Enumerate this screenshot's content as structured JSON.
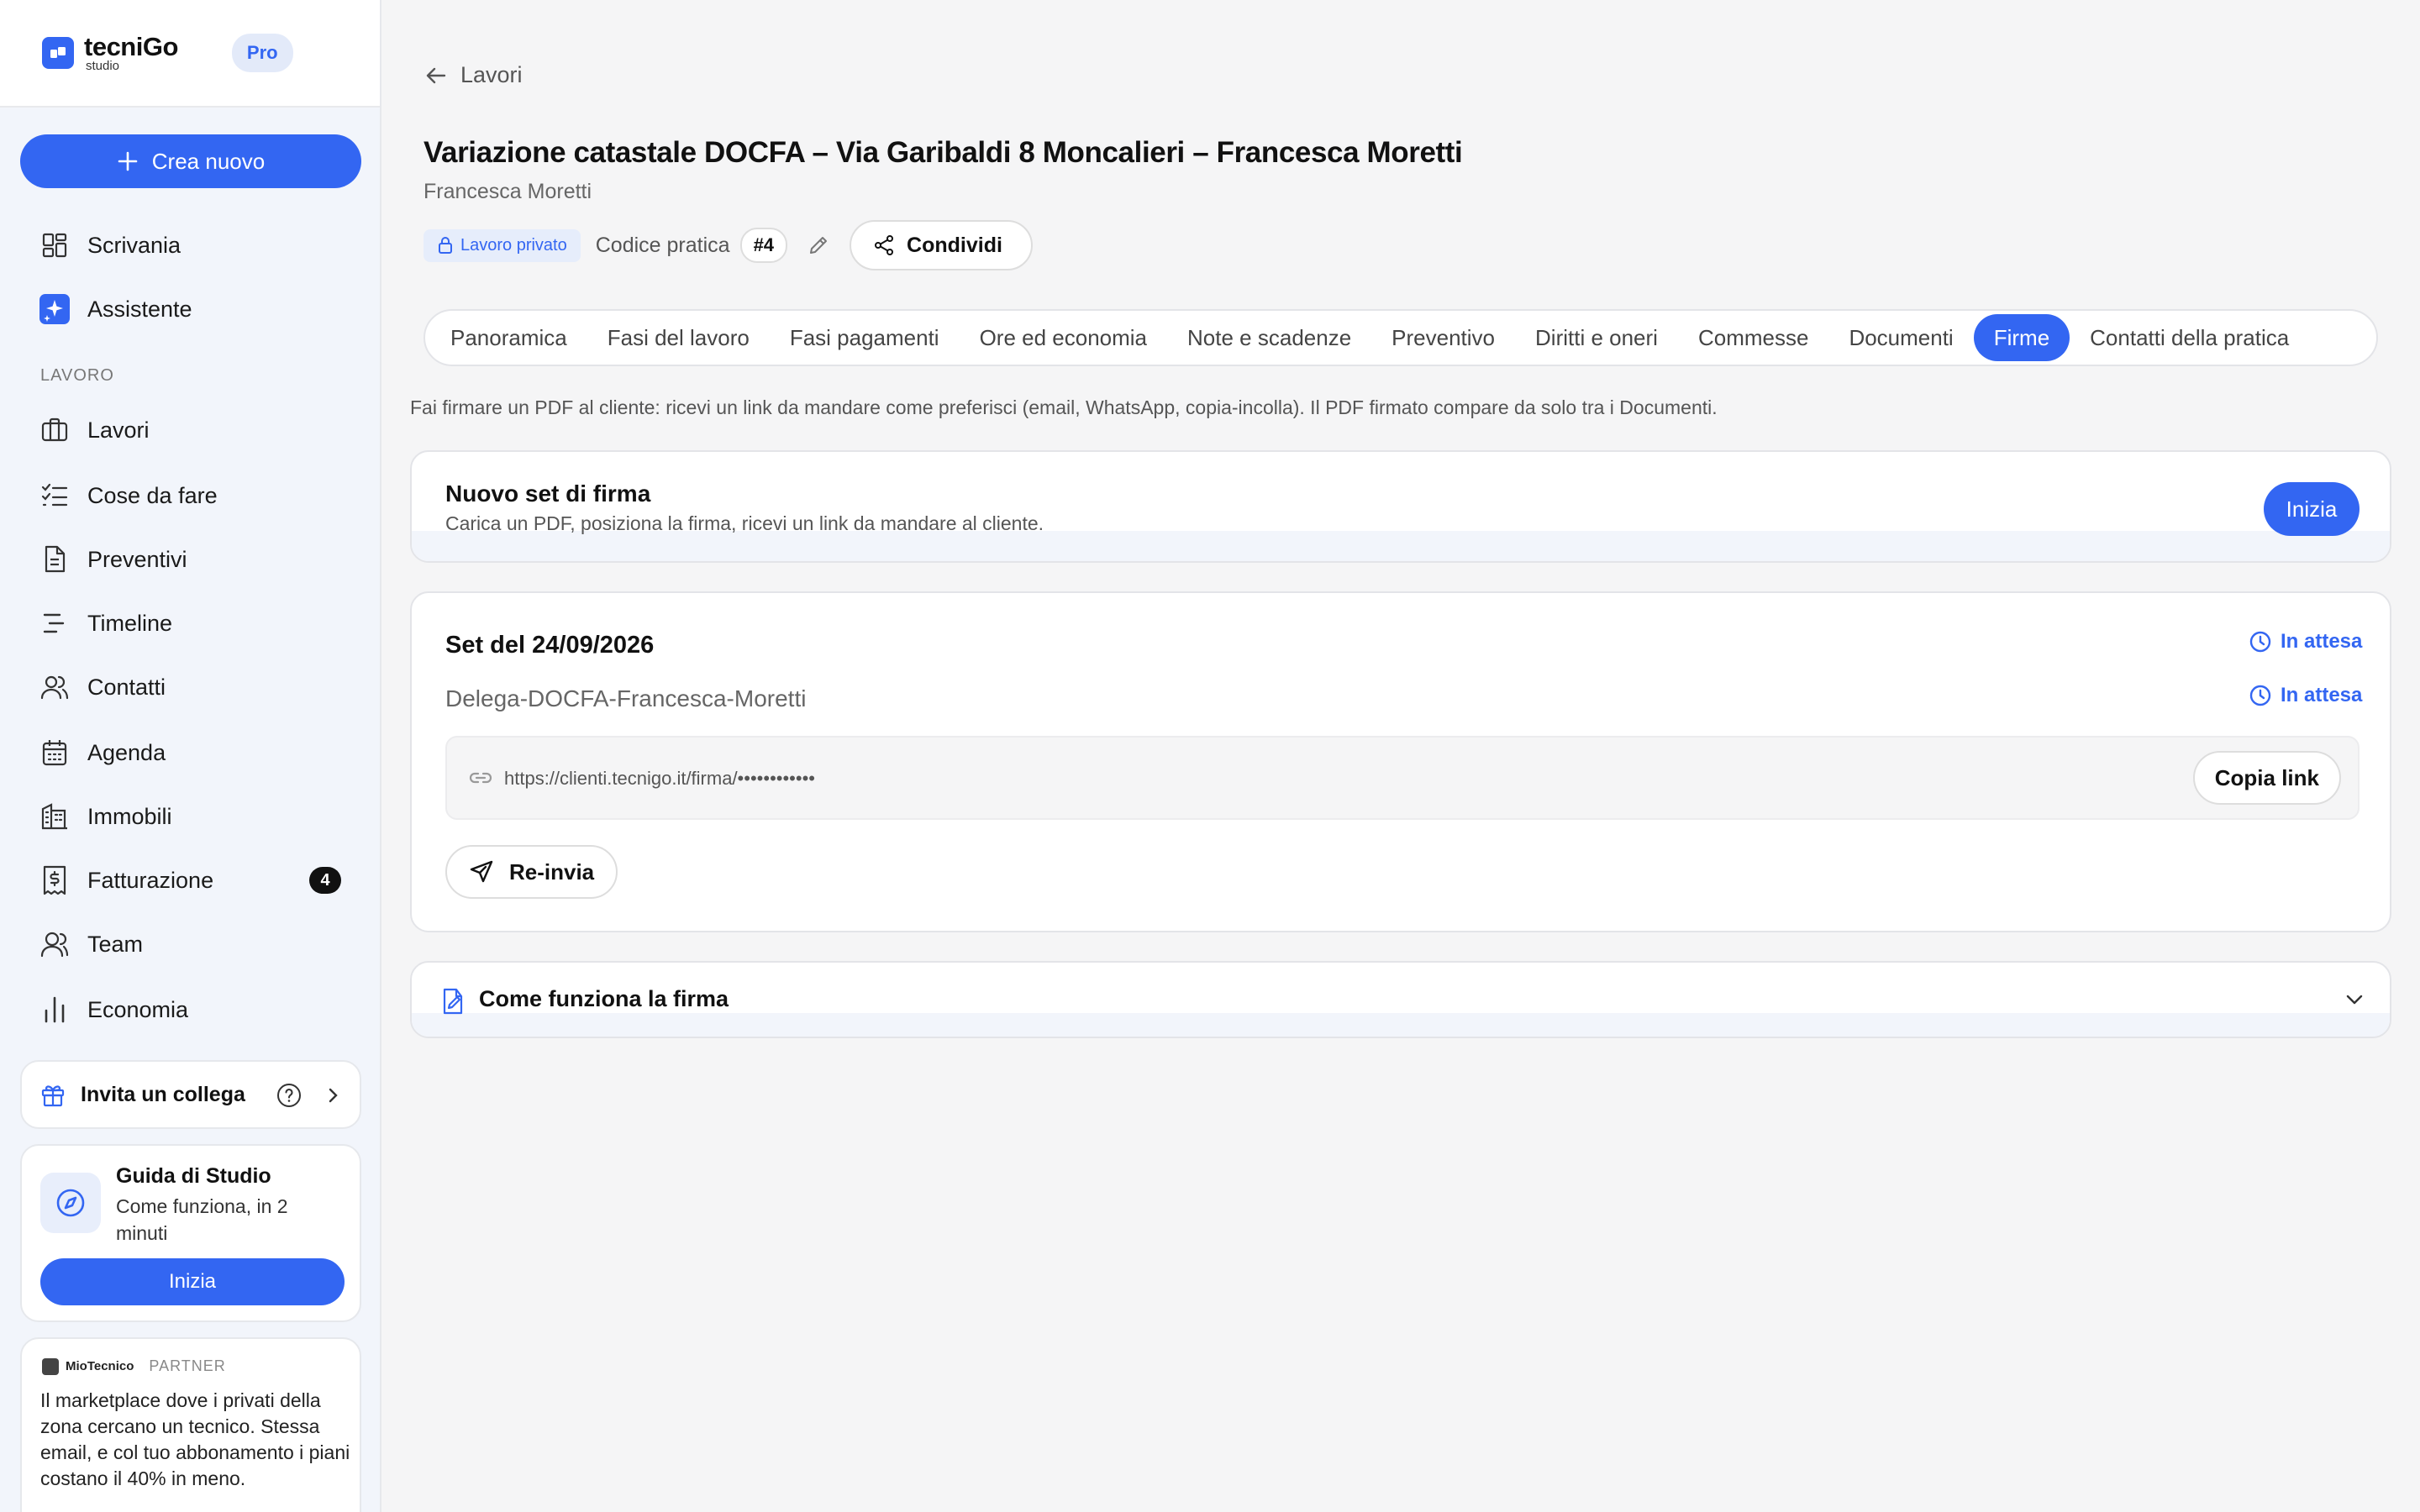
{
  "sidebar": {
    "brand": {
      "name": "tecniGo",
      "sub": "studio",
      "plan": "Pro"
    },
    "create_label": "Crea nuovo",
    "top_items": [
      {
        "label": "Scrivania",
        "icon": "dashboard-icon"
      },
      {
        "label": "Assistente",
        "icon": "sparkle-icon"
      }
    ],
    "section_label": "LAVORO",
    "items": [
      {
        "label": "Lavori",
        "icon": "briefcase-icon"
      },
      {
        "label": "Cose da fare",
        "icon": "checklist-icon"
      },
      {
        "label": "Preventivi",
        "icon": "document-icon"
      },
      {
        "label": "Timeline",
        "icon": "timeline-icon"
      },
      {
        "label": "Contatti",
        "icon": "users-icon"
      },
      {
        "label": "Agenda",
        "icon": "calendar-icon"
      },
      {
        "label": "Immobili",
        "icon": "building-icon"
      },
      {
        "label": "Fatturazione",
        "icon": "invoice-icon",
        "badge": "4"
      },
      {
        "label": "Team",
        "icon": "team-icon"
      },
      {
        "label": "Economia",
        "icon": "bar-chart-icon"
      }
    ],
    "invite": {
      "label": "Invita un collega"
    },
    "guide": {
      "title": "Guida di Studio",
      "subtitle": "Come funziona, in 2 minuti",
      "button": "Inizia"
    },
    "partner": {
      "brand": "MioTecnico",
      "tag": "PARTNER",
      "text": "Il marketplace dove i privati della zona cercano un tecnico. Stessa email, e col tuo abbonamento i piani costano il 40% in meno."
    }
  },
  "header": {
    "back_label": "Lavori",
    "title": "Variazione catastale DOCFA – Via Garibaldi 8 Moncalieri – Francesca Moretti",
    "subtitle": "Francesca Moretti",
    "private_label": "Lavoro privato",
    "code_label": "Codice pratica",
    "code_value": "#4",
    "share_label": "Condividi"
  },
  "tabs": [
    {
      "label": "Panoramica",
      "active": false
    },
    {
      "label": "Fasi del lavoro",
      "active": false
    },
    {
      "label": "Fasi pagamenti",
      "active": false
    },
    {
      "label": "Ore ed economia",
      "active": false
    },
    {
      "label": "Note e scadenze",
      "active": false
    },
    {
      "label": "Preventivo",
      "active": false
    },
    {
      "label": "Diritti e oneri",
      "active": false
    },
    {
      "label": "Commesse",
      "active": false
    },
    {
      "label": "Documenti",
      "active": false
    },
    {
      "label": "Firme",
      "active": true
    },
    {
      "label": "Contatti della pratica",
      "active": false
    }
  ],
  "firme": {
    "intro": "Fai firmare un PDF al cliente: ricevi un link da mandare come preferisci (email, WhatsApp, copia-incolla). Il PDF firmato compare da solo tra i Documenti.",
    "new_set": {
      "title": "Nuovo set di firma",
      "subtitle": "Carica un PDF, posiziona la firma, ricevi un link da mandare al cliente.",
      "button": "Inizia"
    },
    "set": {
      "title": "Set del 24/09/2026",
      "status": "In attesa",
      "document": "Delega-DOCFA-Francesca-Moretti",
      "document_status": "In attesa",
      "link": "https://clienti.tecnigo.it/firma/••••••••••••",
      "copy_label": "Copia link",
      "resend_label": "Re-invia"
    },
    "howto": {
      "title": "Come funziona la firma"
    }
  },
  "colors": {
    "accent": "#3366f2",
    "text": "#111111",
    "muted": "#666666"
  }
}
